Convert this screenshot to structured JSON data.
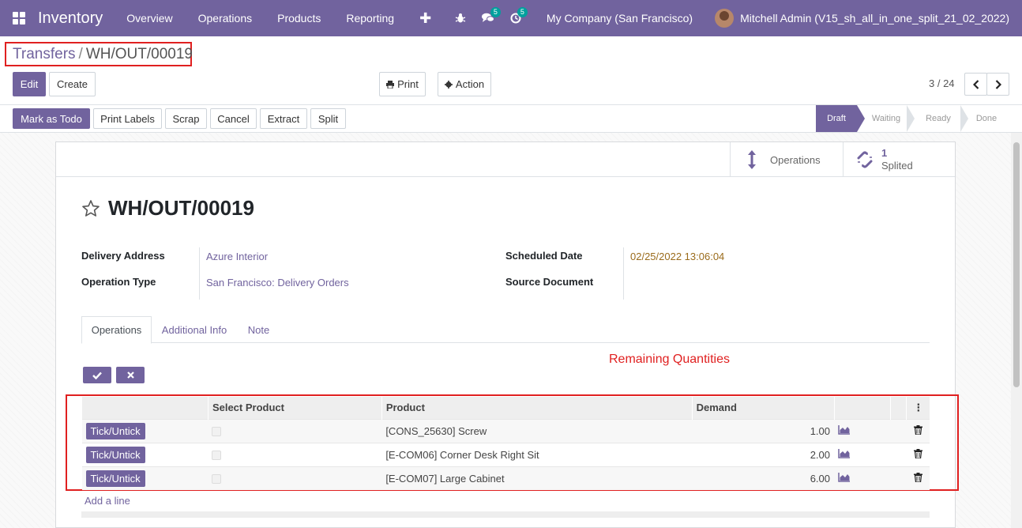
{
  "navbar": {
    "app_name": "Inventory",
    "menu": [
      "Overview",
      "Operations",
      "Products",
      "Reporting"
    ],
    "plus": "✚",
    "chat_badge": "5",
    "activity_badge": "5",
    "company": "My Company (San Francisco)",
    "user": "Mitchell Admin (V15_sh_all_in_one_split_21_02_2022)"
  },
  "breadcrumb": {
    "parent": "Transfers",
    "separator": "/",
    "current": "WH/OUT/00019"
  },
  "control": {
    "edit": "Edit",
    "create": "Create",
    "print": "Print",
    "action": "Action",
    "pager": "3 / 24"
  },
  "statusbar": {
    "buttons": [
      "Mark as Todo",
      "Print Labels",
      "Scrap",
      "Cancel",
      "Extract",
      "Split"
    ],
    "stages": [
      "Draft",
      "Waiting",
      "Ready",
      "Done"
    ],
    "active_stage": "Draft"
  },
  "smart_buttons": {
    "operations": "Operations",
    "splited_count": "1",
    "splited_label": "Splited"
  },
  "form": {
    "title": "WH/OUT/00019",
    "delivery_address_label": "Delivery Address",
    "delivery_address": "Azure Interior",
    "operation_type_label": "Operation Type",
    "operation_type": "San Francisco: Delivery Orders",
    "scheduled_date_label": "Scheduled Date",
    "scheduled_date": "02/25/2022 13:06:04",
    "source_document_label": "Source Document"
  },
  "tabs": [
    "Operations",
    "Additional Info",
    "Note"
  ],
  "annotation": "Remaining Quantities",
  "table": {
    "headers": [
      "Select Product",
      "Product",
      "Demand"
    ],
    "tick_label": "Tick/Untick",
    "rows": [
      {
        "product": "[CONS_25630] Screw",
        "demand": "1.00"
      },
      {
        "product": "[E-COM06] Corner Desk Right Sit",
        "demand": "2.00"
      },
      {
        "product": "[E-COM07] Large Cabinet",
        "demand": "6.00"
      }
    ],
    "add_line": "Add a line"
  },
  "colors": {
    "brand": "#71639e",
    "annotation_red": "#e02020"
  }
}
